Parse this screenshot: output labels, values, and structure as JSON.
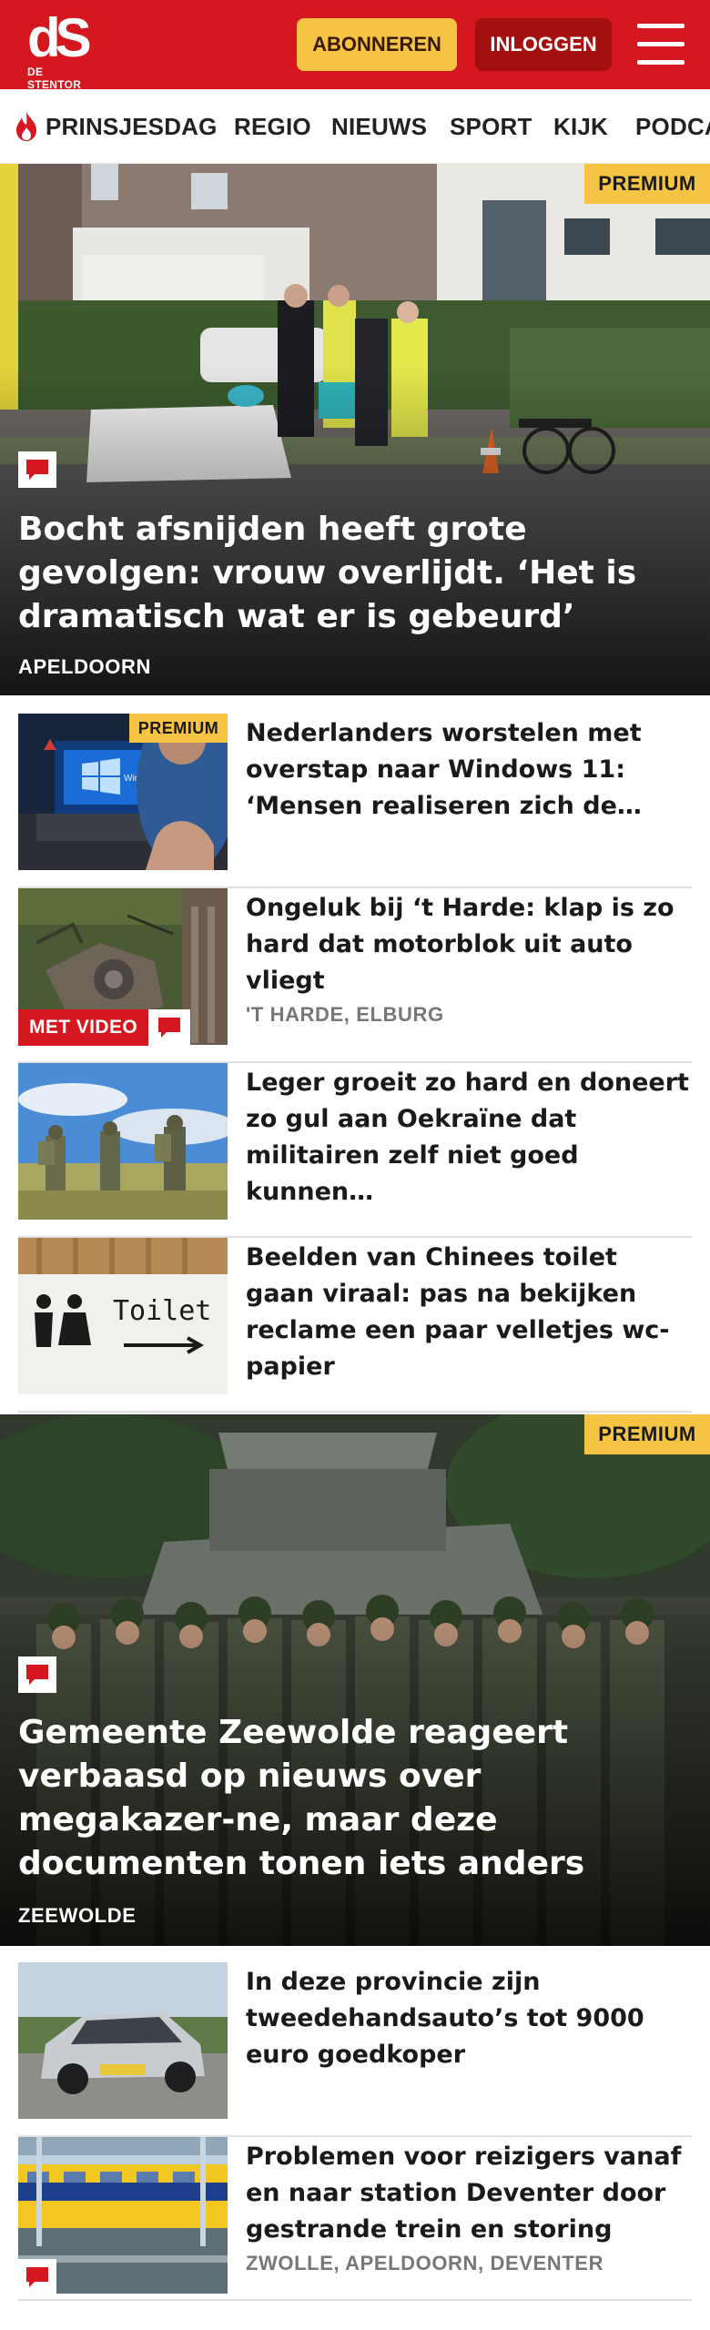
{
  "header": {
    "logo_mark": "dS",
    "logo_name": "DE STENTOR",
    "subscribe_label": "ABONNEREN",
    "login_label": "INLOGGEN",
    "brand_color": "#d5181f",
    "accent_color": "#f6c445"
  },
  "nav": {
    "items": [
      "PRINSJESDAG",
      "REGIO",
      "NIEUWS",
      "SPORT",
      "KIJK",
      "PODCA"
    ]
  },
  "badges": {
    "premium": "PREMIUM",
    "video": "MET VIDEO"
  },
  "hero1": {
    "title": "Bocht afsnijden heeft grote gevolgen: vrouw overlijdt. ‘Het is dramatisch wat er is gebeurd’",
    "location": "APELDOORN"
  },
  "list1": [
    {
      "title": "Nederlanders worstelen met overstap naar Windows 11: ‘Mensen realiseren zich de…",
      "location": ""
    },
    {
      "title": "Ongeluk bij ‘t Harde: klap is zo hard dat motorblok uit auto vliegt",
      "location": "'T HARDE, ELBURG"
    },
    {
      "title": "Leger groeit zo hard en doneert zo gul aan Oekraïne dat militairen zelf niet goed kunnen…",
      "location": ""
    },
    {
      "title": "Beelden van Chinees toilet gaan viraal: pas na bekijken reclame een paar velletjes wc-papier",
      "location": ""
    }
  ],
  "thumb_text": {
    "windows": "Windows 10",
    "toilet": "Toilet"
  },
  "hero2": {
    "title": "Gemeente Zeewolde reageert verbaasd op nieuws over megakazer-ne, maar deze documenten tonen iets anders",
    "location": "ZEEWOLDE"
  },
  "list2": [
    {
      "title": "In deze provincie zijn tweedehandsauto’s tot 9000 euro goedkoper",
      "location": ""
    },
    {
      "title": "Problemen voor reizigers vanaf en naar station Deventer door gestrande trein en storing",
      "location": "ZWOLLE, APELDOORN, DEVENTER"
    }
  ]
}
